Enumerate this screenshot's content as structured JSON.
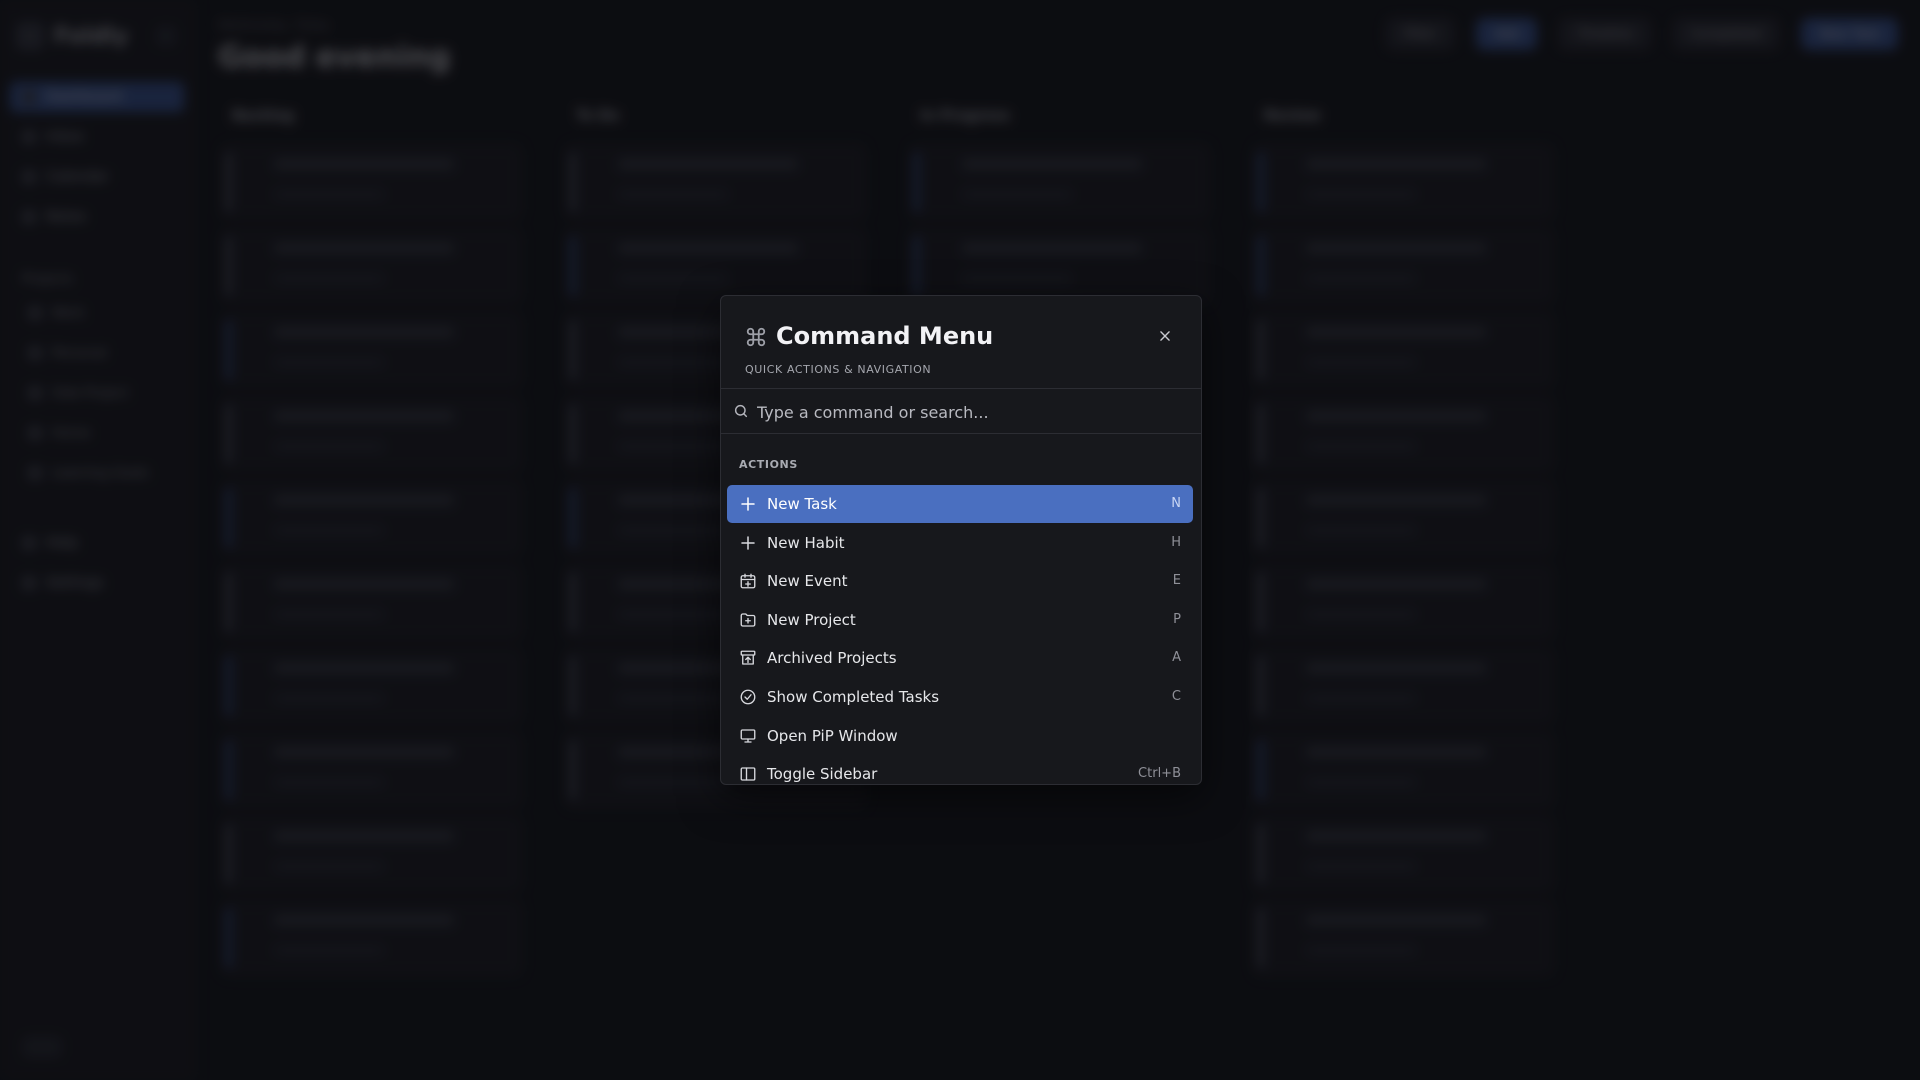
{
  "background_app": {
    "logo_text": "Foldly",
    "greeting": "Good evening",
    "breadcrumb": "Wednesday, Today",
    "nav_items": [
      "Dashboard",
      "Inbox",
      "Calendar",
      "Notes"
    ],
    "projects_header": "Projects",
    "project_items": [
      "Work",
      "Personal",
      "Side Project",
      "Home",
      "Learning Goals"
    ],
    "bottom_items": [
      "Help",
      "Settings"
    ],
    "topbar": [
      "Filter",
      "Add",
      "Timeline",
      "Completed",
      "New Task"
    ],
    "columns": [
      "Backlog",
      "To Do",
      "In Progress",
      "Review"
    ]
  },
  "modal": {
    "title": "Command Menu",
    "subtitle": "QUICK ACTIONS & NAVIGATION",
    "close_icon": "close-icon",
    "search": {
      "placeholder": "Type a command or search...",
      "value": ""
    },
    "section_label": "ACTIONS",
    "items": [
      {
        "label": "New Task",
        "shortcut": "N",
        "icon": "plus-icon",
        "selected": true
      },
      {
        "label": "New Habit",
        "shortcut": "H",
        "icon": "plus-icon",
        "selected": false
      },
      {
        "label": "New Event",
        "shortcut": "E",
        "icon": "calendar-plus-icon",
        "selected": false
      },
      {
        "label": "New Project",
        "shortcut": "P",
        "icon": "folder-plus-icon",
        "selected": false
      },
      {
        "label": "Archived Projects",
        "shortcut": "A",
        "icon": "archive-icon",
        "selected": false
      },
      {
        "label": "Show Completed Tasks",
        "shortcut": "C",
        "icon": "check-circle-icon",
        "selected": false
      },
      {
        "label": "Open PiP Window",
        "shortcut": "",
        "icon": "monitor-icon",
        "selected": false
      },
      {
        "label": "Toggle Sidebar",
        "shortcut": "Ctrl+B",
        "icon": "sidebar-icon",
        "selected": false
      }
    ]
  },
  "colors": {
    "accent": "#4a6fc0",
    "modal_bg": "#17181c",
    "page_bg": "#121317"
  }
}
